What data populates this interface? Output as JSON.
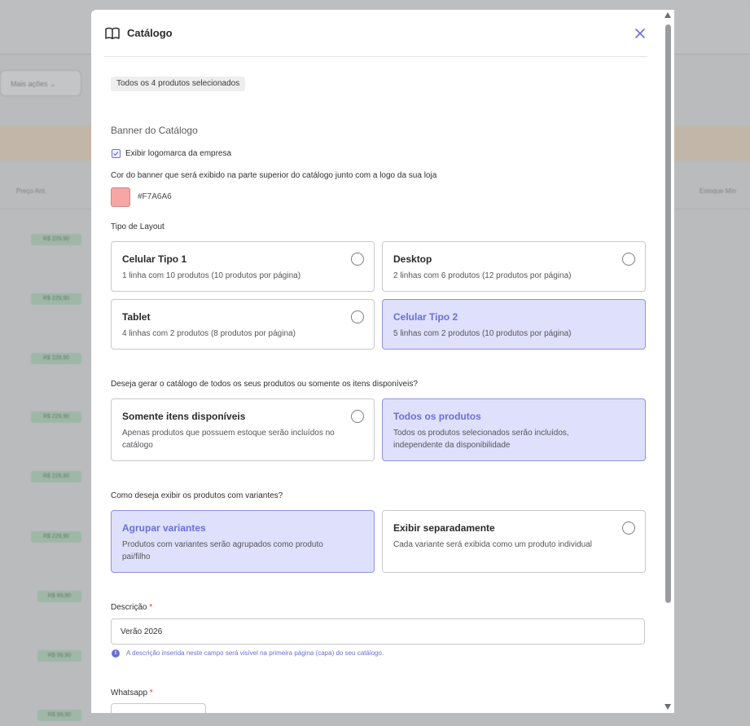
{
  "background": {
    "more_actions_label": "Mais ações",
    "columns": [
      "Preço Ant.",
      "Estoque Mín"
    ],
    "price_values": [
      "R$ 229,90",
      "R$ 229,90",
      "R$ 229,90",
      "R$ 229,90",
      "R$ 229,90",
      "R$ 229,90",
      "R$ 99,90",
      "R$ 99,90",
      "R$ 99,90"
    ]
  },
  "modal": {
    "title": "Catálogo",
    "icon": "book-open-icon",
    "close_icon": "close-icon",
    "selection_chip": "Todos os 4 produtos selecionados",
    "banner_section_title": "Banner do Catálogo",
    "show_logo_label": "Exibir logomarca da empresa",
    "show_logo_checked": true,
    "banner_color_label": "Cor do banner que será exibido na parte superior do catálogo junto com a logo da sua loja",
    "banner_color_hex": "#F7A6A6",
    "layout_label": "Tipo de Layout",
    "layouts": [
      {
        "title": "Celular Tipo 1",
        "desc": "1 linha com 10 produtos (10 produtos por página)",
        "selected": false
      },
      {
        "title": "Desktop",
        "desc": "2 linhas com 6 produtos (12 produtos por página)",
        "selected": false
      },
      {
        "title": "Tablet",
        "desc": "4 linhas com 2 produtos (8 produtos por página)",
        "selected": false
      },
      {
        "title": "Celular Tipo 2",
        "desc": "5 linhas com 2 produtos (10 produtos por página)",
        "selected": true
      }
    ],
    "availability_label": "Deseja gerar o catálogo de todos os seus produtos ou somente os itens disponíveis?",
    "availability_options": [
      {
        "title": "Somente itens disponíveis",
        "desc": "Apenas produtos que possuem estoque serão incluídos no catálogo",
        "selected": false
      },
      {
        "title": "Todos os produtos",
        "desc": "Todos os produtos selecionados serão incluídos, independente da disponibilidade",
        "selected": true
      }
    ],
    "variants_label": "Como deseja exibir os produtos com variantes?",
    "variant_options": [
      {
        "title": "Agrupar variantes",
        "desc": "Produtos com variantes serão agrupados como produto pai/filho",
        "selected": true
      },
      {
        "title": "Exibir separadamente",
        "desc": "Cada variante será exibida como um produto individual",
        "selected": false
      }
    ],
    "description_label": "Descrição",
    "required_mark": "*",
    "description_value": "Verão 2026",
    "description_hint": "A descrição inserida neste campo será visível na primeira página (capa) do seu catálogo.",
    "whatsapp_label": "Whatsapp"
  },
  "colors": {
    "accent": "#6A6FD9",
    "selected_card_bg": "#DFE0FB",
    "banner_swatch": "#F7A6A6"
  }
}
